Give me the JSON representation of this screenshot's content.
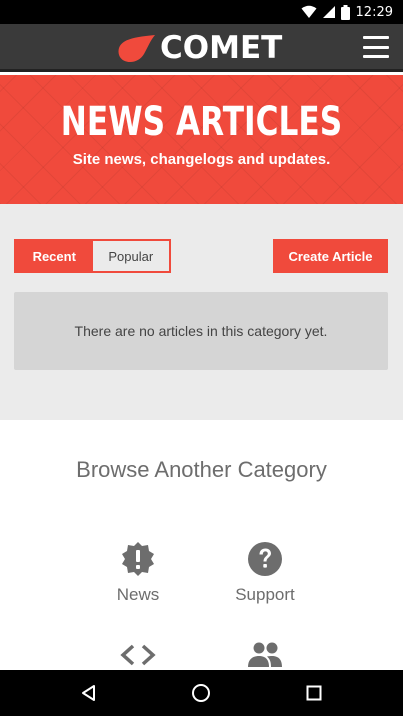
{
  "status_bar": {
    "time": "12:29"
  },
  "app_bar": {
    "logo_text": "COMET",
    "logo_color": "#f04a3c",
    "menu_icon": "hamburger-menu-icon"
  },
  "hero": {
    "title": "NEWS ARTICLES",
    "subtitle": "Site news, changelogs and updates.",
    "background": "#f04a3c"
  },
  "articles": {
    "tabs": [
      {
        "label": "Recent",
        "active": true
      },
      {
        "label": "Popular",
        "active": false
      }
    ],
    "create_button": "Create Article",
    "empty_message": "There are no articles in this category yet."
  },
  "browse": {
    "title": "Browse Another Category",
    "categories": [
      {
        "label": "News",
        "icon": "exclamation-badge-icon"
      },
      {
        "label": "Support",
        "icon": "question-circle-icon"
      },
      {
        "label": "",
        "icon": "code-icon"
      },
      {
        "label": "",
        "icon": "people-icon"
      }
    ]
  },
  "nav_bar": {
    "buttons": [
      "back-icon",
      "home-icon",
      "recents-icon"
    ]
  }
}
